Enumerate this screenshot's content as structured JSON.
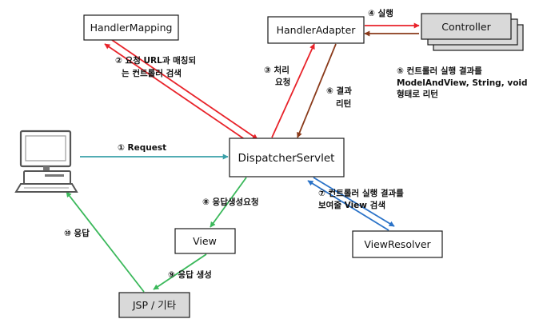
{
  "colors": {
    "red": "#e8232a",
    "darkred": "#8a3a1a",
    "teal": "#3aa0a8",
    "green": "#3ab85a",
    "blue": "#2b73c8",
    "gray": "#d9d9d9"
  },
  "icons": {
    "client": "desktop-computer-icon"
  },
  "nodes": {
    "handler_mapping": "HandlerMapping",
    "handler_adapter": "HandlerAdapter",
    "controller": "Controller",
    "dispatcher": "DispatcherServlet",
    "view": "View",
    "view_resolver": "ViewResolver",
    "jsp": "JSP / 기타"
  },
  "steps": {
    "s1": "① Request",
    "s2_line1": "② 요청 URL과 매칭되",
    "s2_line2": "는 컨트롤러 검색",
    "s3_line1": "③ 처리",
    "s3_line2": "요청",
    "s4": "④ 실행",
    "s5_line1": "⑤ 컨트롤러 실행 결과를",
    "s5_line2": "ModelAndView, String, void",
    "s5_line3": "형태로 리턴",
    "s6_line1": "⑥ 결과",
    "s6_line2": "리턴",
    "s7_line1": "⑦ 컨트롤러 실행 결과를",
    "s7_line2": "보여줄 View 검색",
    "s8": "⑧ 응답생성요청",
    "s9": "⑨ 응답 생성",
    "s10": "⑩ 응답"
  }
}
